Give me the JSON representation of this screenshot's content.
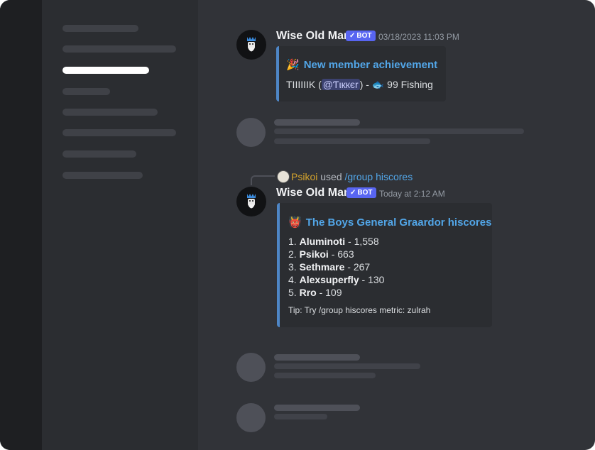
{
  "colors": {
    "background": "#313338",
    "sidebar": "#2b2d31",
    "rail": "#1e1f22",
    "embed_border": "#4e86c6",
    "link": "#52a6e8",
    "bot_tag": "#5865f2",
    "command_user": "#d4a32c"
  },
  "messages": [
    {
      "author": "Wise Old Man",
      "tag": "BOT",
      "timestamp": "03/18/2023 11:03 PM",
      "embed": {
        "icon": "party-popper-icon",
        "icon_glyph": "🎉",
        "title": "New member achievement",
        "body_prefix": "TIIIIIIK (",
        "mention": "@Ƭιккєr",
        "body_mid": ") - ",
        "skill_icon": "fishing-icon",
        "skill_glyph": "🐟",
        "body_suffix": "99 Fishing"
      }
    },
    {
      "command": {
        "user": "Psikoi",
        "used": "used",
        "name": "/group hiscores"
      },
      "author": "Wise Old Man",
      "tag": "BOT",
      "timestamp": "Today at 2:12 AM",
      "embed": {
        "icon": "general-graardor-icon",
        "icon_glyph": "👹",
        "title": "The Boys General Graardor hiscores",
        "rows": [
          {
            "rank": "1.",
            "name": "Aluminoti",
            "value": "- 1,558"
          },
          {
            "rank": "2.",
            "name": "Psikoi",
            "value": "- 663"
          },
          {
            "rank": "3.",
            "name": "Sethmare",
            "value": "- 267"
          },
          {
            "rank": "4.",
            "name": "Alexsuperfly",
            "value": "- 130"
          },
          {
            "rank": "5.",
            "name": "Rro",
            "value": "- 109"
          }
        ],
        "tip": "Tip: Try /group hiscores metric: zulrah"
      }
    }
  ]
}
